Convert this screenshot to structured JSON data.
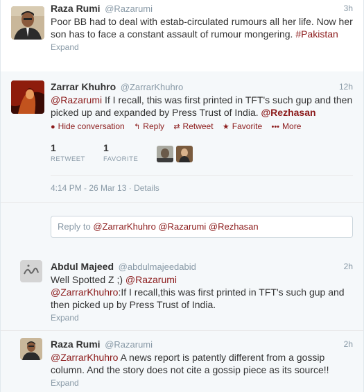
{
  "colors": {
    "link": "#8b1a1a",
    "muted": "#8899a6",
    "text": "#333333"
  },
  "tweets": [
    {
      "name": "Raza Rumi",
      "handle": "@Razarumi",
      "time": "3h",
      "text": "Poor BB had to deal with estab-circulated rumours all her life. Now her son has to face a constant assault of rumour mongering.",
      "hashtag": "#Pakistan",
      "expand": "Expand"
    },
    {
      "name": "Zarrar Khuhro",
      "handle": "@ZarrarKhuhro",
      "time": "12h",
      "mention1": "@Razarumi",
      "text": " If I recall, this was first printed in TFT's such gup and then picked up and expanded by Press Trust of India. ",
      "mention2": "@Rezhasan",
      "actions": {
        "hide": "Hide conversation",
        "reply": "Reply",
        "retweet": "Retweet",
        "favorite": "Favorite",
        "more": "More"
      },
      "stats": {
        "retweets": "1",
        "retweets_label": "RETWEET",
        "favorites": "1",
        "favorites_label": "FAVORITE"
      },
      "timestamp": "4:14 PM - 26 Mar 13",
      "dot": "·",
      "details": "Details"
    },
    {
      "name": "Abdul Majeed",
      "handle": "@abdulmajeedabid",
      "time": "2h",
      "line1": "Well Spotted Z ;) ",
      "mention1": "@Razarumi",
      "mention2": "@ZarrarKhuhro",
      "text": ":If I recall,this was first printed in TFT's such gup and then picked up by Press Trust of India.",
      "expand": "Expand"
    },
    {
      "name": "Raza Rumi",
      "handle": "@Razarumi",
      "time": "2h",
      "mention1": "@ZarrarKhuhro",
      "text": " A news report is patently different from a gossip column. And the story does not cite a gossip piece as its source!!",
      "expand": "Expand"
    }
  ],
  "reply_box": {
    "prefix": "Reply to ",
    "mention1": "@ZarrarKhuhro",
    "mention2": "@Razarumi",
    "mention3": "@Rezhasan"
  }
}
